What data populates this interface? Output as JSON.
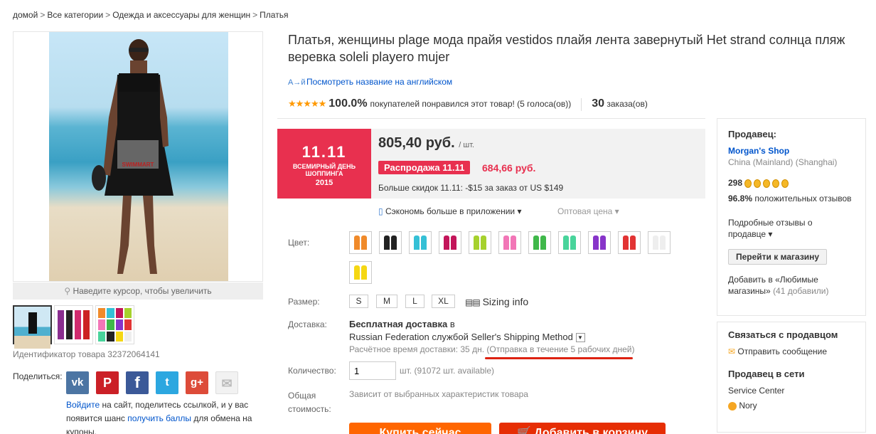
{
  "breadcrumb": {
    "items": [
      "домой",
      "Все категории",
      "Одежда и аксессуары для женщин",
      "Платья"
    ],
    "sep": ">"
  },
  "gallery": {
    "zoom_hint": "Наведите курсор, чтобы увеличить",
    "watermark": "SWIMMART"
  },
  "product": {
    "title": "Платья, женщины plage мода прайя vestidos плайя лента завернутый Het strand солнца пляж веревка soleli playero mujer",
    "english_link": "Посмотреть название на английском",
    "stars": "★★★★★",
    "rating_pct": "100.0%",
    "rating_text": "покупателей понравился этот товар! (5 голоса(ов))",
    "orders_count": "30",
    "orders_label": "заказа(ов)",
    "id_label": "Идентификатор товара 32372064141"
  },
  "promo": {
    "line1": "11.11",
    "line2": "ВСЕМИРНЫЙ ДЕНЬ",
    "line3": "ШОППИНГА",
    "line4": "2015"
  },
  "price": {
    "value": "805,40 руб.",
    "unit": "/ шт.",
    "sale_badge": "Распродажа 11.11",
    "sale_price": "684,66 руб.",
    "discount": "Больше скидок 11.11: -$15 за заказ от US $149",
    "app": "Сэкономь больше в приложении ▾",
    "wholesale": "Оптовая цена ▾"
  },
  "props": {
    "color_label": "Цвет:",
    "size_label": "Размер:",
    "sizes": [
      "S",
      "M",
      "L",
      "XL"
    ],
    "sizing": "Sizing info",
    "shipping_label": "Доставка:",
    "free_shipping": "Бесплатная доставка",
    "ship_in": "в",
    "ship_method": "Russian Federation службой Seller's Shipping Method",
    "ship_time": "Расчётное время доставки: 35 дн.",
    "dispatch": "(Отправка в течение 5 рабочих дней)",
    "qty_label": "Количество:",
    "qty": "1",
    "qty_avail": "шт. (91072 шт. available)",
    "total_label1": "Общая",
    "total_label2": "стоимость:",
    "total_text": "Зависит от выбранных характеристик товара",
    "buy": "Купить сейчас",
    "cart": "Добавить в корзину"
  },
  "swatch_colors": [
    "#f08a2a",
    "#222222",
    "#35c0d6",
    "#c3155a",
    "#a6d12d",
    "#f276b7",
    "#3fb84a",
    "#48d49b",
    "#8734c9",
    "#e23434",
    "#eeeeee",
    "#f5d713"
  ],
  "share": {
    "label": "Поделиться:",
    "icons": [
      "vk-icon",
      "pinterest-icon",
      "facebook-icon",
      "twitter-icon",
      "googleplus-icon",
      "email-icon"
    ]
  },
  "note": {
    "login": "Войдите",
    "t1": " на сайт, поделитесь ссылкой, и у вас появится шанс ",
    "points": "получить баллы",
    "t2": " для обмена на купоны."
  },
  "seller": {
    "heading": "Продавец:",
    "shop": "Morgan's Shop",
    "location": "China (Mainland) (Shanghai)",
    "score": "298",
    "positive_pct": "96.8%",
    "positive_text": "положительных отзывов",
    "detail": "Подробные отзывы о продавце ▾",
    "visit": "Перейти к магазину",
    "fav": "Добавить в «Любимые магазины»",
    "fav_count": "(41 добавили)"
  },
  "contact": {
    "heading": "Связаться с продавцом",
    "message": "Отправить сообщение",
    "online_heading": "Продавец в сети",
    "service": "Service Center",
    "agent": "Nory"
  }
}
